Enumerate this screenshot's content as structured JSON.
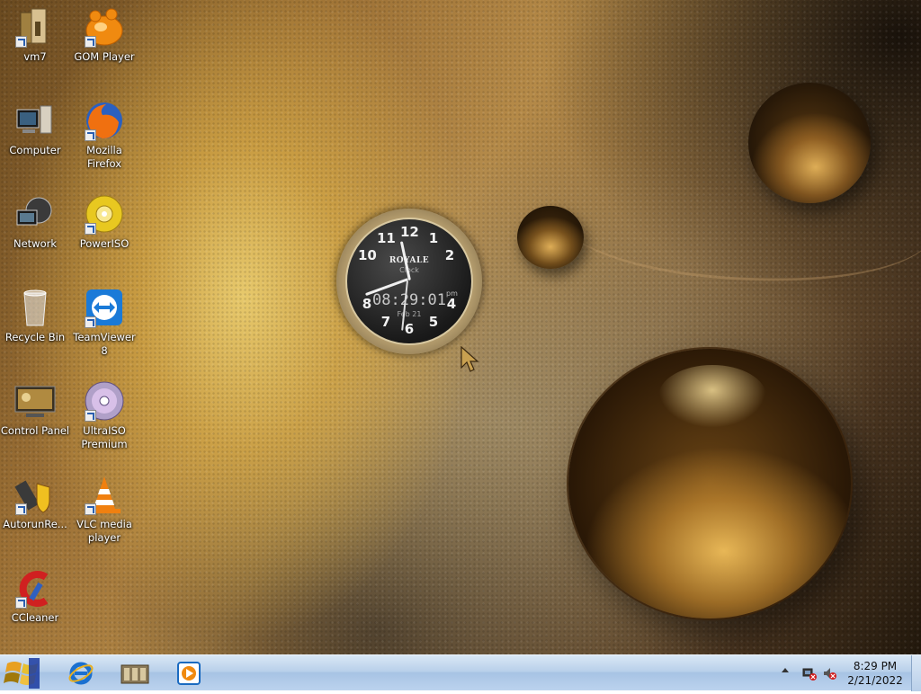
{
  "desktop": {
    "icons": [
      {
        "label": "vm7"
      },
      {
        "label": "GOM Player"
      },
      {
        "label": "Computer"
      },
      {
        "label": "Mozilla Firefox"
      },
      {
        "label": "Network"
      },
      {
        "label": "PowerISO"
      },
      {
        "label": "Recycle Bin"
      },
      {
        "label": "TeamViewer 8"
      },
      {
        "label": "Control Panel"
      },
      {
        "label": "UltraISO Premium"
      },
      {
        "label": "AutorunRe..."
      },
      {
        "label": "VLC media player"
      },
      {
        "label": "CCleaner"
      }
    ]
  },
  "gadget": {
    "brand": "ROYALE",
    "subtitle": "Clock",
    "digital_time": "08:29:01",
    "ampm": "pm",
    "date": "Feb 21",
    "numbers": [
      "12",
      "1",
      "2",
      "4",
      "5",
      "6",
      "7",
      "8",
      "10",
      "11"
    ]
  },
  "taskbar": {
    "pinned": [
      {
        "name": "internet-explorer-icon"
      },
      {
        "name": "file-manager-icon"
      },
      {
        "name": "media-player-icon"
      }
    ],
    "clock_time": "8:29 PM",
    "clock_date": "2/21/2022"
  },
  "colors": {
    "taskbar_top": "#d9e7f5",
    "taskbar_bottom": "#a7c3e4"
  }
}
